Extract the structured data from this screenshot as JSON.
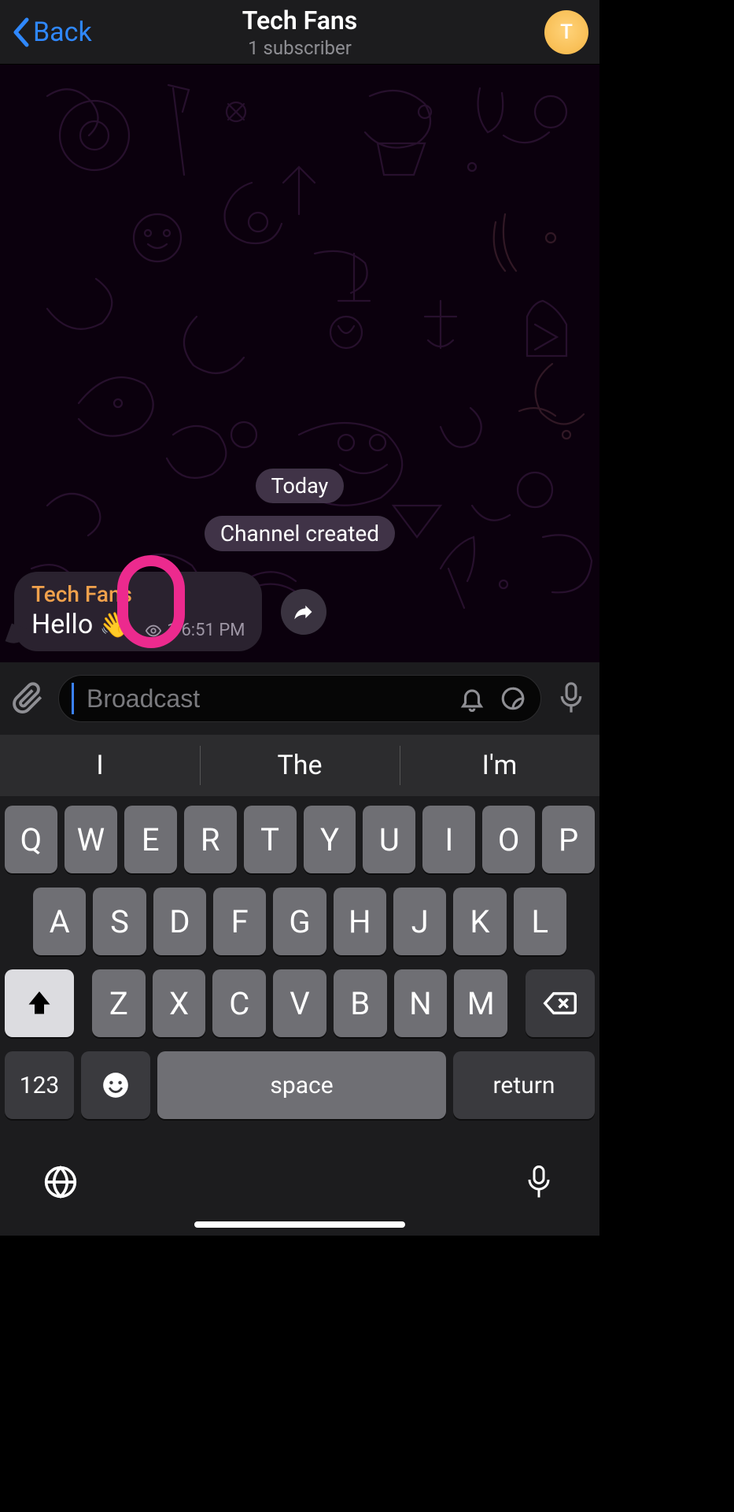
{
  "header": {
    "back_label": "Back",
    "title": "Tech Fans",
    "subtitle": "1 subscriber",
    "avatar_letter": "T"
  },
  "chat": {
    "date_label": "Today",
    "system_message": "Channel created",
    "message": {
      "sender": "Tech Fans",
      "text": "Hello",
      "emoji": "👋",
      "views": "1",
      "time": "6:51 PM"
    }
  },
  "compose": {
    "placeholder": "Broadcast"
  },
  "keyboard": {
    "suggestions": [
      "I",
      "The",
      "I'm"
    ],
    "row1": [
      "Q",
      "W",
      "E",
      "R",
      "T",
      "Y",
      "U",
      "I",
      "O",
      "P"
    ],
    "row2": [
      "A",
      "S",
      "D",
      "F",
      "G",
      "H",
      "J",
      "K",
      "L"
    ],
    "row3": [
      "Z",
      "X",
      "C",
      "V",
      "B",
      "N",
      "M"
    ],
    "num_key": "123",
    "space_label": "space",
    "return_label": "return"
  }
}
